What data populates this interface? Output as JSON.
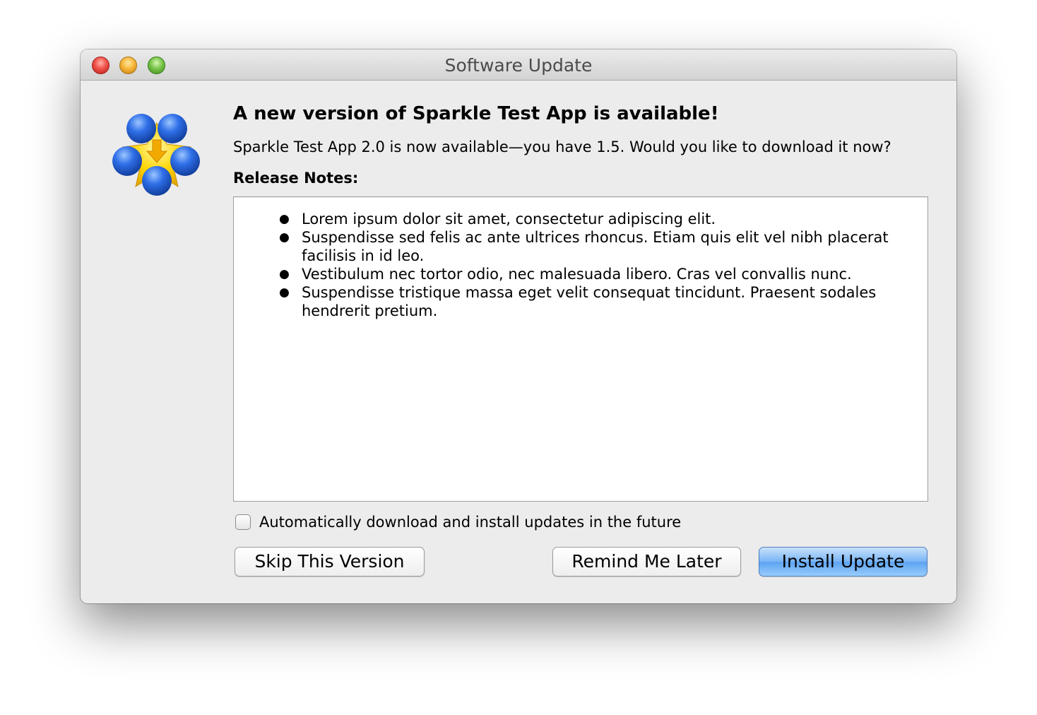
{
  "window": {
    "title": "Software Update"
  },
  "dialog": {
    "headline": "A new version of Sparkle Test App is available!",
    "subtext": "Sparkle Test App 2.0 is now available—you have 1.5. Would you like to download it now?",
    "release_notes_label": "Release Notes:",
    "release_notes": [
      "Lorem ipsum dolor sit amet, consectetur adipiscing elit.",
      "Suspendisse sed felis ac ante ultrices rhoncus. Etiam quis elit vel nibh placerat facilisis in id leo.",
      "Vestibulum nec tortor odio, nec malesuada libero. Cras vel convallis nunc.",
      "Suspendisse tristique massa eget velit consequat tincidunt. Praesent sodales hendrerit pretium."
    ],
    "auto_update_label": "Automatically download and install updates in the future",
    "auto_update_checked": false
  },
  "buttons": {
    "skip": "Skip This Version",
    "remind": "Remind Me Later",
    "install": "Install Update"
  },
  "icons": {
    "app": "sparkle-app-icon",
    "close": "close-icon",
    "minimize": "minimize-icon",
    "zoom": "zoom-icon"
  },
  "colors": {
    "accent": "#5da3f2",
    "sparkle_blue": "#2f6fe8",
    "sparkle_yellow": "#ffd400"
  }
}
